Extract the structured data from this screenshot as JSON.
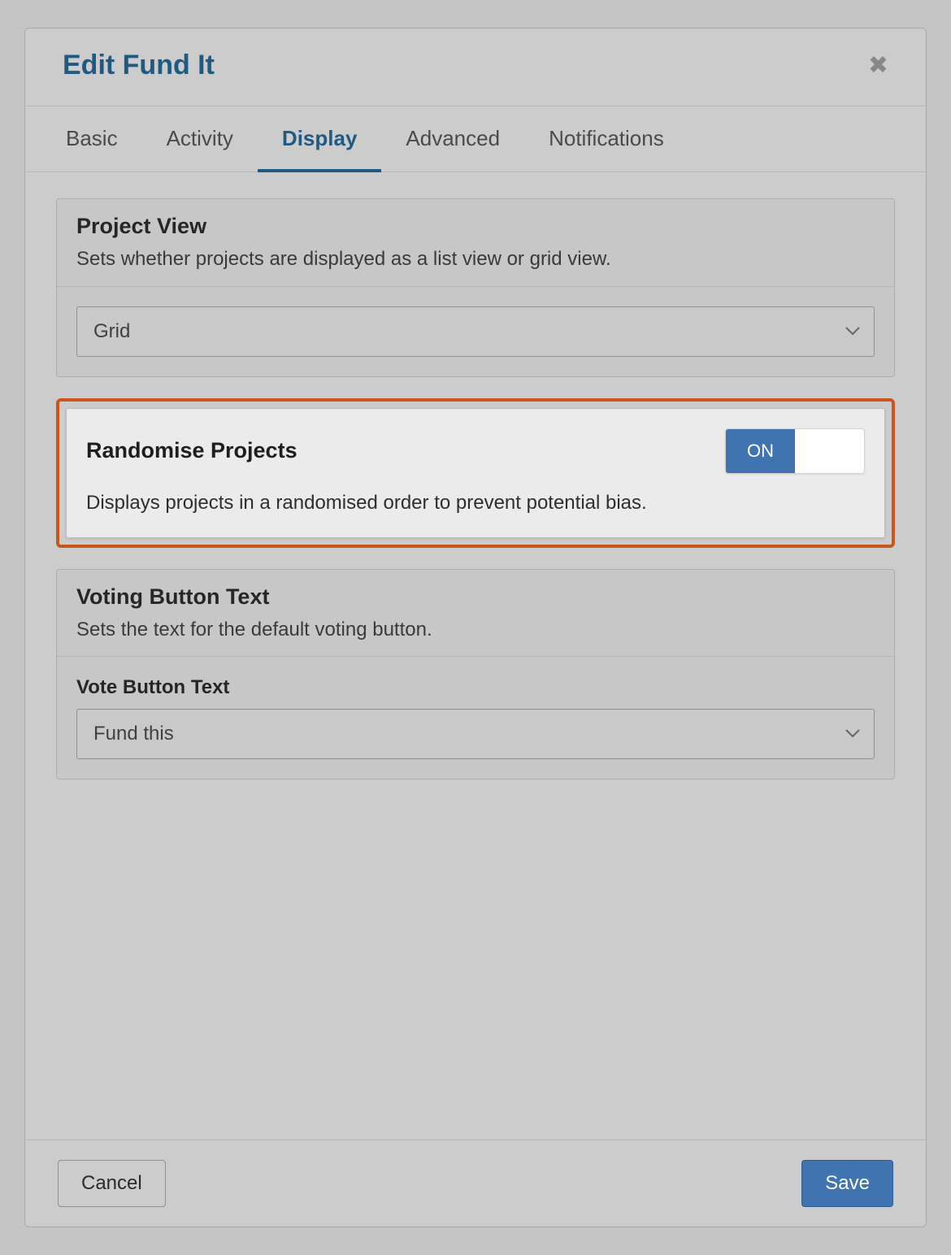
{
  "header": {
    "title": "Edit Fund It"
  },
  "tabs": [
    {
      "label": "Basic",
      "active": false
    },
    {
      "label": "Activity",
      "active": false
    },
    {
      "label": "Display",
      "active": true
    },
    {
      "label": "Advanced",
      "active": false
    },
    {
      "label": "Notifications",
      "active": false
    }
  ],
  "project_view": {
    "title": "Project View",
    "description": "Sets whether projects are displayed as a list view or grid view.",
    "value": "Grid"
  },
  "randomise": {
    "title": "Randomise Projects",
    "description": "Displays projects in a randomised order to prevent potential bias.",
    "state_label": "ON",
    "on": true
  },
  "voting": {
    "title": "Voting Button Text",
    "description": "Sets the text for the default voting button.",
    "field_label": "Vote Button Text",
    "value": "Fund this"
  },
  "footer": {
    "cancel": "Cancel",
    "save": "Save"
  }
}
